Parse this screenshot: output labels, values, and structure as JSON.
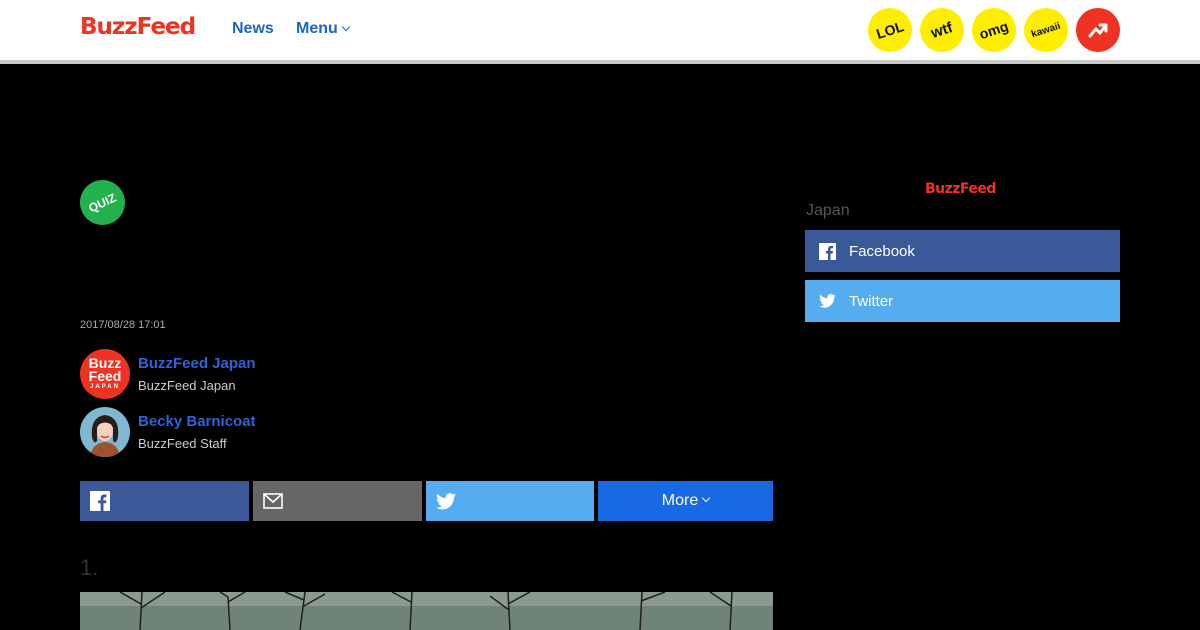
{
  "header": {
    "logo_text": "BuzzFeed",
    "nav_news": "News",
    "nav_menu": "Menu",
    "badges": [
      "LOL",
      "wtf",
      "omg",
      "kawaii"
    ],
    "trending_icon": "trending-arrow-icon"
  },
  "article": {
    "quiz_badge": "QUIZ",
    "date": "2017/08/28 17:01",
    "authors": [
      {
        "name": "BuzzFeed Japan",
        "role": "BuzzFeed Japan",
        "avatar_text": [
          "Buzz",
          "Feed",
          "JAPAN"
        ]
      },
      {
        "name": "Becky Barnicoat",
        "role": "BuzzFeed Staff"
      }
    ],
    "share": {
      "more_label": "More"
    },
    "item_number": "1."
  },
  "sidebar": {
    "logo_text": "BuzzFeed",
    "label": "Japan",
    "facebook_label": "Facebook",
    "twitter_label": "Twitter"
  },
  "colors": {
    "brand_red": "#ee3322",
    "link_blue": "#1b66c9",
    "facebook": "#3b5998",
    "twitter": "#55acee",
    "more_blue": "#1668e3",
    "badge_yellow": "#ffee00",
    "quiz_green": "#22b14c"
  }
}
